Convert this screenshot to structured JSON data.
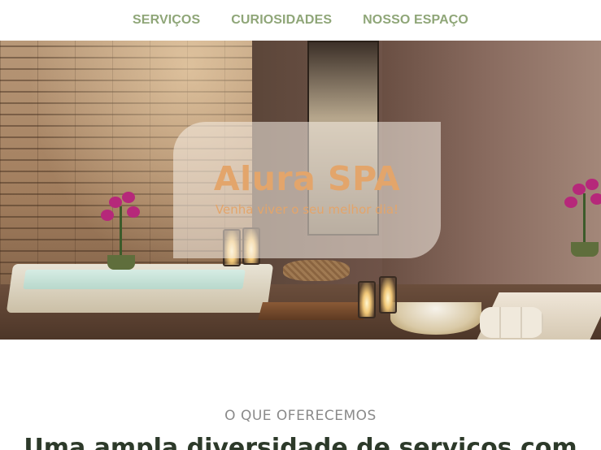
{
  "nav": {
    "items": [
      {
        "label": "SERVIÇOS"
      },
      {
        "label": "CURIOSIDADES"
      },
      {
        "label": "NOSSO ESPAÇO"
      }
    ]
  },
  "hero": {
    "title": "Alura SPA",
    "subtitle": "Venha viver o seu melhor dia!"
  },
  "section": {
    "eyebrow": "O QUE OFERECEMOS",
    "title": "Uma ampla diversidade de serviços com"
  },
  "colors": {
    "nav_link": "#8fa678",
    "hero_text": "#e3a56b",
    "eyebrow": "#8a8a8a",
    "section_title": "#2d3a2a"
  }
}
